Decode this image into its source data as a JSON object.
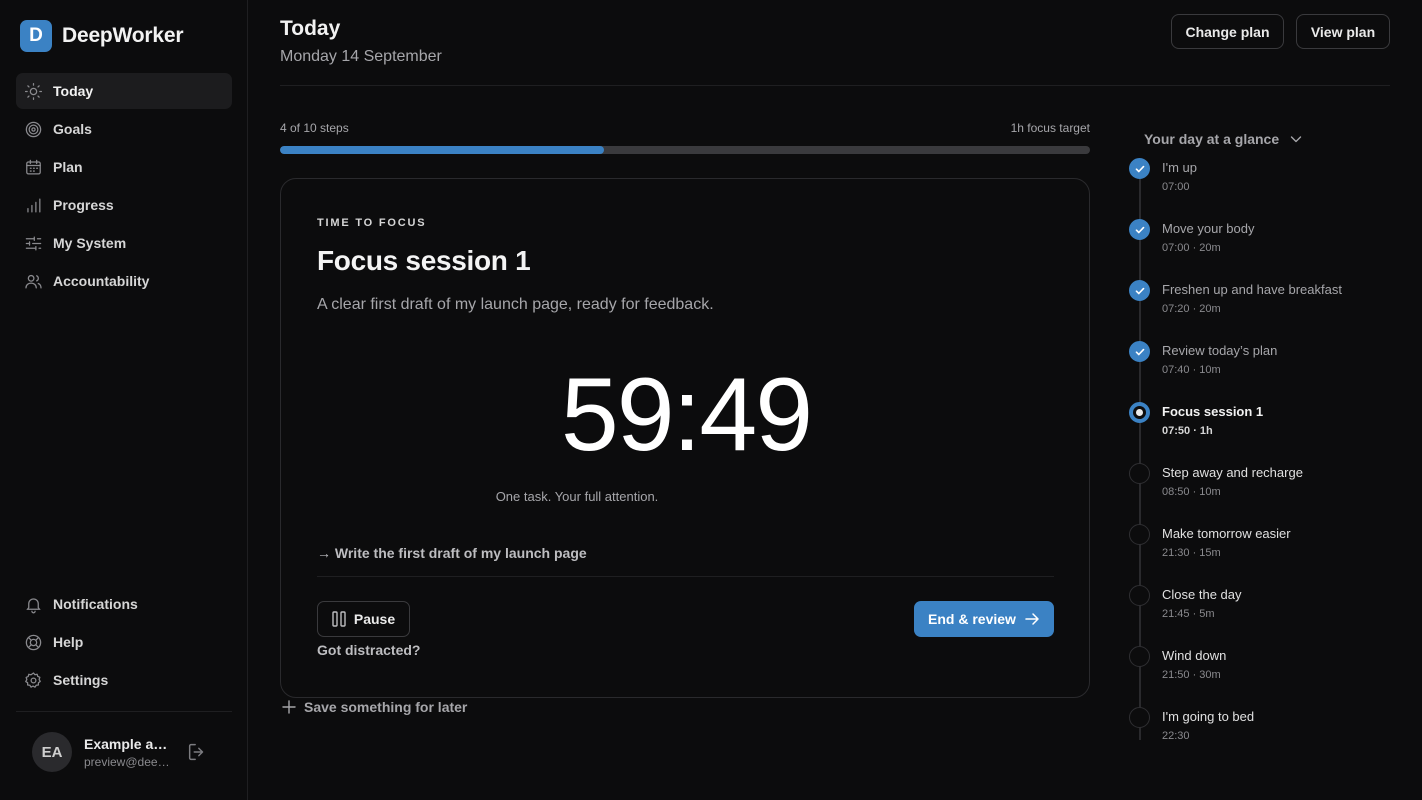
{
  "brand": {
    "logo_letter": "D",
    "name": "DeepWorker"
  },
  "sidebar": {
    "items": [
      {
        "label": "Today",
        "icon": "sun-icon",
        "active": true
      },
      {
        "label": "Goals",
        "icon": "target-icon"
      },
      {
        "label": "Plan",
        "icon": "calendar-icon"
      },
      {
        "label": "Progress",
        "icon": "bar-chart-icon"
      },
      {
        "label": "My System",
        "icon": "sliders-icon"
      },
      {
        "label": "Accountability",
        "icon": "users-icon"
      }
    ],
    "bottom_items": [
      {
        "label": "Notifications",
        "icon": "bell-icon"
      },
      {
        "label": "Help",
        "icon": "lifebuoy-icon"
      },
      {
        "label": "Settings",
        "icon": "gear-icon"
      }
    ],
    "user": {
      "initials": "EA",
      "name": "Example account",
      "email": "preview@deepworker.app"
    }
  },
  "header": {
    "title": "Today",
    "date": "Monday 14 September",
    "change_plan": "Change plan",
    "view_plan": "View plan"
  },
  "progress": {
    "steps_label": "4 of 10 steps",
    "target_label": "1h focus target",
    "completed": 4,
    "total": 10
  },
  "session": {
    "eyebrow": "TIME TO FOCUS",
    "title": "Focus session 1",
    "description": "A clear first draft of my launch page, ready for feedback.",
    "timer": "59:49",
    "timer_caption": "One task. Your full attention.",
    "task": "→ Write the first draft of my launch page",
    "pause": "Pause",
    "distracted": "Got distracted?",
    "end_review": "End & review"
  },
  "save_later": "Save something for later",
  "timeline": {
    "heading": "Your day at a glance",
    "items": [
      {
        "title": "I'm up",
        "time": "07:00",
        "state": "done"
      },
      {
        "title": "Move your body",
        "time": "07:00 · 20m",
        "state": "done"
      },
      {
        "title": "Freshen up and have breakfast",
        "time": "07:20 · 20m",
        "state": "done"
      },
      {
        "title": "Review today’s plan",
        "time": "07:40 · 10m",
        "state": "done"
      },
      {
        "title": "Focus session 1",
        "time": "07:50 · 1h",
        "state": "current"
      },
      {
        "title": "Step away and recharge",
        "time": "08:50 · 10m",
        "state": "upcoming"
      },
      {
        "title": "Make tomorrow easier",
        "time": "21:30 · 15m",
        "state": "upcoming"
      },
      {
        "title": "Close the day",
        "time": "21:45 · 5m",
        "state": "upcoming"
      },
      {
        "title": "Wind down",
        "time": "21:50 · 30m",
        "state": "upcoming"
      },
      {
        "title": "I'm going to bed",
        "time": "22:30",
        "state": "upcoming"
      }
    ]
  },
  "colors": {
    "accent": "#3b82c4",
    "background": "#0c0c0d",
    "border": "#2a2a2d"
  }
}
